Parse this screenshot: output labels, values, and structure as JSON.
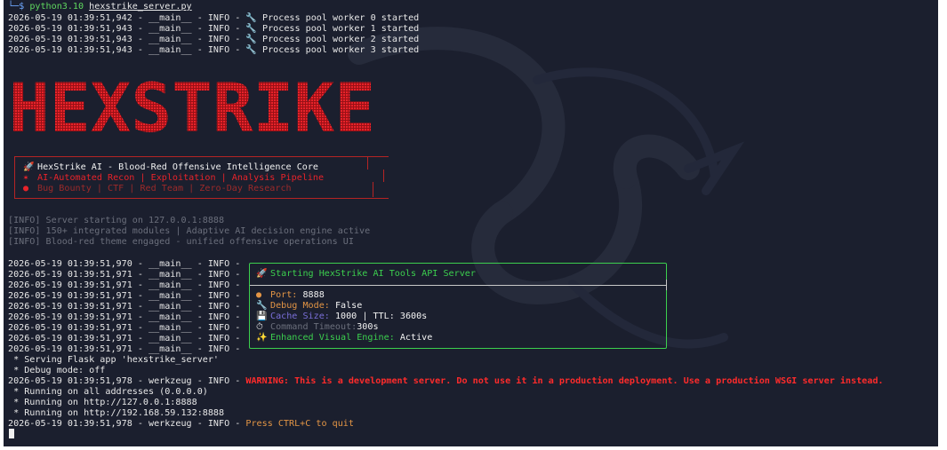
{
  "prompt": {
    "arrow": "└─$",
    "python": "python3.10",
    "script": "hexstrike_server.py"
  },
  "startup_logs": [
    "2026-05-19 01:39:51,942 - __main__ - INFO - 🔧 Process pool worker 0 started",
    "2026-05-19 01:39:51,943 - __main__ - INFO - 🔧 Process pool worker 1 started",
    "2026-05-19 01:39:51,943 - __main__ - INFO - 🔧 Process pool worker 2 started",
    "2026-05-19 01:39:51,943 - __main__ - INFO - 🔧 Process pool worker 3 started"
  ],
  "banner": {
    "logo_text": "HEXSTRIKE",
    "color": "#e8232a"
  },
  "core_box": {
    "line1_icon": "rocket-icon",
    "line1": "HexStrike AI - Blood-Red Offensive Intelligence Core",
    "line2_icon": "star-icon",
    "line2": "AI-Automated Recon | Exploitation | Analysis Pipeline",
    "line3_icon": "red-circle-icon",
    "line3": "Bug Bounty | CTF | Red Team | Zero-Day Research"
  },
  "info_lines": [
    "[INFO] Server starting on 127.0.0.1:8888",
    "[INFO] 150+ integrated modules | Adaptive AI decision engine active",
    "[INFO] Blood-red theme engaged - unified offensive operations UI"
  ],
  "main_log_prefixes": [
    "2026-05-19 01:39:51,970 - __main__ - INFO -",
    "2026-05-19 01:39:51,971 - __main__ - INFO -",
    "2026-05-19 01:39:51,971 - __main__ - INFO -",
    "2026-05-19 01:39:51,971 - __main__ - INFO -",
    "2026-05-19 01:39:51,971 - __main__ - INFO -",
    "2026-05-19 01:39:51,971 - __main__ - INFO -",
    "2026-05-19 01:39:51,971 - __main__ - INFO -",
    "2026-05-19 01:39:51,971 - __main__ - INFO -",
    "2026-05-19 01:39:51,971 - __main__ - INFO -"
  ],
  "api_box": {
    "title": "Starting HexStrike AI Tools API Server",
    "port_label": "Port:",
    "port_value": "8888",
    "debug_label": "Debug Mode:",
    "debug_value": "False",
    "cache_label": "Cache Size:",
    "cache_value": "1000 | TTL: 3600s",
    "timeout_label": "Command Timeout:",
    "timeout_value": "300s",
    "visual_label": "Enhanced Visual Engine:",
    "visual_value": "Active"
  },
  "flask": {
    "serving": " * Serving Flask app 'hexstrike_server'",
    "debug": " * Debug mode: off",
    "warn_prefix": "2026-05-19 01:39:51,978 - werkzeug - INFO -",
    "warning": "WARNING: This is a development server. Do not use it in a production deployment. Use a production WSGI server instead.",
    "run_all": " * Running on all addresses (0.0.0.0)",
    "run_local": " * Running on http://127.0.0.1:8888",
    "run_lan": " * Running on http://192.168.59.132:8888",
    "quit_prefix": "2026-05-19 01:39:51,978 - werkzeug - INFO -",
    "quit": "Press CTRL+C to quit"
  }
}
